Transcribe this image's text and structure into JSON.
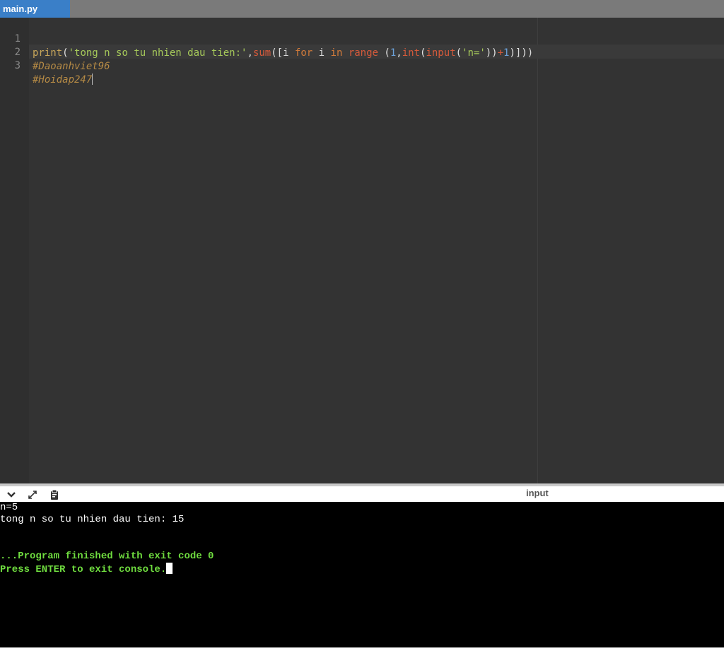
{
  "tabs": [
    {
      "label": "main.py",
      "active": true
    }
  ],
  "editor": {
    "lines": [
      {
        "number": "1",
        "tokens": {
          "t1": "print",
          "t2": "(",
          "t3": "'tong n so tu nhien dau tien:'",
          "t4": ",",
          "t5": "sum",
          "t6": "([",
          "t7": "i ",
          "t8": "for",
          "t9": " i ",
          "t10": "in",
          "t11": " ",
          "t12": "range",
          "t13": " (",
          "t14": "1",
          "t15": ",",
          "t16": "int",
          "t17": "(",
          "t18": "input",
          "t19": "(",
          "t20": "'n='",
          "t21": "))",
          "t22": "+",
          "t23": "1",
          "t24": ")]))"
        }
      },
      {
        "number": "2",
        "text": "#Daoanhviet96"
      },
      {
        "number": "3",
        "text": "#Hoidap247"
      }
    ],
    "colors": {
      "background": "#333333",
      "function": "#c8a65a",
      "string": "#a6c95a",
      "builtin": "#d65a3a",
      "keyword": "#d07a3a",
      "number": "#6aa0d8",
      "comment": "#b58a45"
    }
  },
  "console_toolbar": {
    "collapse_icon": "chevron-down-icon",
    "expand_icon": "expand-arrows-icon",
    "copy_icon": "clipboard-icon",
    "input_label": "input"
  },
  "console": {
    "lines": [
      {
        "text": "n=5",
        "color": "#ffffff"
      },
      {
        "text": "tong n so tu nhien dau tien: 15",
        "color": "#ffffff"
      },
      {
        "text": "...Program finished with exit code 0",
        "color": "#6fdc3f"
      },
      {
        "text": "Press ENTER to exit console.",
        "color": "#6fdc3f"
      }
    ]
  }
}
